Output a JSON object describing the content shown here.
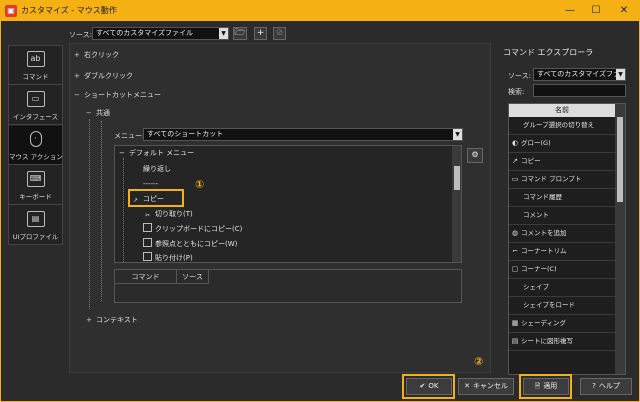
{
  "window": {
    "title": "カスタマイズ - マウス動作",
    "controls": {
      "minimize": "—",
      "maximize": "☐",
      "close": "✕"
    }
  },
  "source": {
    "label": "ソース:",
    "value": "すべてのカスタマイズファイル"
  },
  "nav": {
    "items": [
      {
        "label": "コマンド",
        "icon": "command-icon"
      },
      {
        "label": "インタフェース",
        "icon": "monitor-icon"
      },
      {
        "label": "マウス アクション",
        "icon": "mouse-icon",
        "active": true
      },
      {
        "label": "キーボード",
        "icon": "keyboard-icon"
      },
      {
        "label": "UIプロファイル",
        "icon": "ui-profile-icon"
      }
    ]
  },
  "tree": {
    "right_click": "右クリック",
    "double_click": "ダブルクリック",
    "shortcut_menu": "ショートカットメニュー",
    "common": "共通",
    "context": "コンテキスト",
    "menu_label": "メニュー:",
    "menu_value": "すべてのショートカット"
  },
  "menu_tree": {
    "root": "デフォルト メニュー",
    "items": [
      {
        "label": "繰り返し",
        "icon": ""
      },
      {
        "label": "------",
        "icon": ""
      },
      {
        "label": "コピー",
        "icon": "copy-icon"
      },
      {
        "label": "切り取り(T)",
        "icon": "cut-icon"
      },
      {
        "label": "クリップボードにコピー(C)",
        "icon": "clipboard-copy-icon"
      },
      {
        "label": "参照点とともにコピー(W)",
        "icon": "copy-base-icon"
      },
      {
        "label": "貼り付け(P)",
        "icon": "paste-icon"
      }
    ]
  },
  "cmd_table": {
    "headers": [
      "コマンド",
      "ソース"
    ]
  },
  "annotations": {
    "one": "①",
    "two": "②"
  },
  "explorer": {
    "title": "コマンド エクスプローラ",
    "source_label": "ソース:",
    "source_value": "すべてのカスタマイズファイル",
    "search_label": "検索:",
    "search_value": "",
    "column": "名前",
    "items": [
      {
        "label": "グループ選択の切り替え",
        "icon": ""
      },
      {
        "label": "グロー(G)",
        "icon": "glow-icon"
      },
      {
        "label": "コピー",
        "icon": "copy-icon"
      },
      {
        "label": "コマンド プロンプト",
        "icon": "prompt-icon"
      },
      {
        "label": "コマンド履歴",
        "icon": ""
      },
      {
        "label": "コメント",
        "icon": ""
      },
      {
        "label": "コメントを追加",
        "icon": "comment-icon"
      },
      {
        "label": "コーナートリム",
        "icon": "corner-trim-icon"
      },
      {
        "label": "コーナー(C)",
        "icon": "corner-icon"
      },
      {
        "label": "シェイプ",
        "icon": ""
      },
      {
        "label": "シェイプをロード",
        "icon": ""
      },
      {
        "label": "シェーディング",
        "icon": "shading-icon"
      },
      {
        "label": "シートに図形複写",
        "icon": "sheet-copy-icon"
      }
    ]
  },
  "buttons": {
    "ok": "OK",
    "cancel": "キャンセル",
    "apply": "適用",
    "help": "ヘルプ"
  },
  "colors": {
    "accent": "#f5b014",
    "background": "#2b2b2b"
  }
}
